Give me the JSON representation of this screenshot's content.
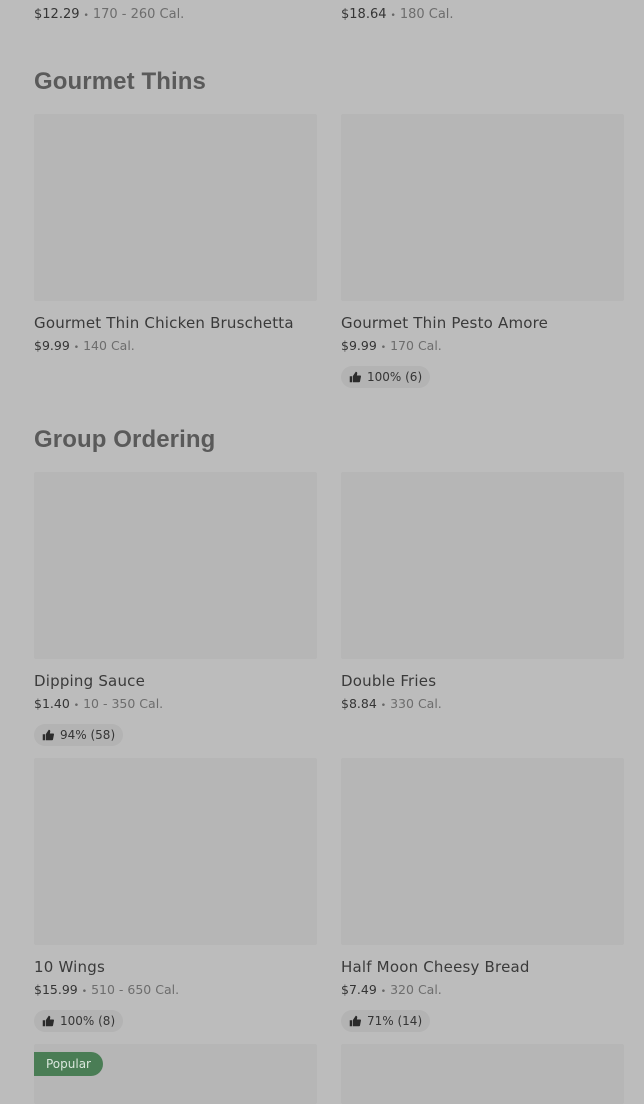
{
  "prev_items": [
    {
      "price": "$12.29",
      "calories": "170 - 260 Cal."
    },
    {
      "price": "$18.64",
      "calories": "180 Cal."
    }
  ],
  "sections": [
    {
      "title": "Gourmet Thins",
      "items": [
        {
          "name": "Gourmet Thin Chicken Bruschetta",
          "price": "$9.99",
          "calories": "140 Cal."
        },
        {
          "name": "Gourmet Thin Pesto Amore",
          "price": "$9.99",
          "calories": "170 Cal.",
          "rating": "100% (6)"
        }
      ]
    },
    {
      "title": "Group Ordering",
      "items": [
        {
          "name": "Dipping Sauce",
          "price": "$1.40",
          "calories": "10 - 350 Cal.",
          "rating": "94% (58)"
        },
        {
          "name": "Double Fries",
          "price": "$8.84",
          "calories": "330 Cal."
        },
        {
          "name": "10 Wings",
          "price": "$15.99",
          "calories": "510 - 650 Cal.",
          "rating": "100% (8)"
        },
        {
          "name": "Half Moon Cheesy Bread",
          "price": "$7.49",
          "calories": "320 Cal.",
          "rating": "71% (14)"
        },
        {
          "badge": "Popular"
        },
        {}
      ]
    }
  ],
  "separator": "•",
  "icons": {
    "rating": "thumbs-up-icon"
  },
  "colors": {
    "badge_bg": "#4a7d55",
    "page_bg": "#bcbcbc",
    "thumb_bg": "#b6b6b6"
  }
}
